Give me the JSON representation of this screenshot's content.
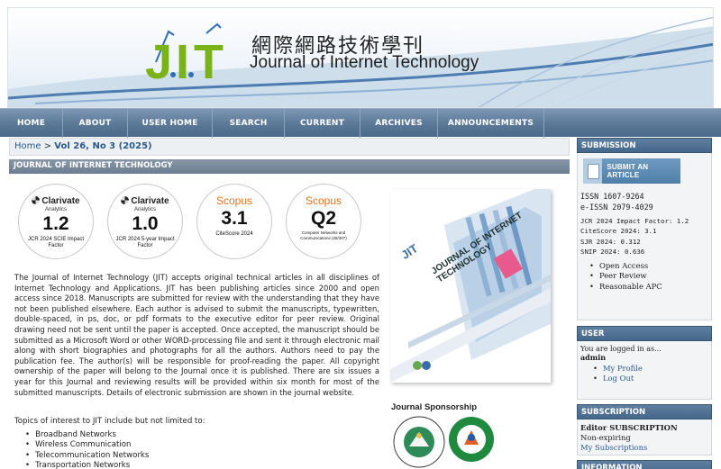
{
  "header": {
    "logo_text": "JIT",
    "title_cn": "網際網路技術學刊",
    "title_en": "Journal of Internet Technology"
  },
  "nav": [
    {
      "label": "HOME"
    },
    {
      "label": "ABOUT"
    },
    {
      "label": "USER HOME"
    },
    {
      "label": "SEARCH"
    },
    {
      "label": "CURRENT"
    },
    {
      "label": "ARCHIVES"
    },
    {
      "label": "ANNOUNCEMENTS"
    }
  ],
  "breadcrumb": {
    "home": "Home",
    "sep": ">",
    "current": "Vol 26, No 3 (2025)"
  },
  "section_title": "JOURNAL OF INTERNET TECHNOLOGY",
  "badges": [
    {
      "brand": "Clarivate",
      "brand_sub": "Analytics",
      "value": "1.2",
      "caption": "JCR 2024 SCIE Impact Factor"
    },
    {
      "brand": "Clarivate",
      "brand_sub": "Analytics",
      "value": "1.0",
      "caption": "JCR 2024 5-year Impact Factor"
    },
    {
      "brand": "Scopus",
      "value": "3.1",
      "caption": "CiteScore 2024"
    },
    {
      "brand": "Scopus",
      "value": "Q2",
      "caption": "Computer Networks and Communications (28/307)"
    }
  ],
  "intro": "The Journal of Internet Technology (JIT) accepts original technical articles in all disciplines of Internet Technology and Applications. JIT has been publishing articles since 2000 and open access since 2018. Manuscripts are submitted for review with the understanding that they have not been published elsewhere. Each author is advised to submit the manuscripts, typewritten, double-spaced, in ps, doc, or pdf formats to the executive editor for peer review. Original drawing need not be sent until the paper is accepted. Once accepted, the manuscript should be submitted as a Microsoft Word or other WORD-processing file and sent it through electronic mail along with short biographies and photographs for all the authors. Authors need to pay the publication fee. The author(s) will be responsible for proof-reading the paper. All copyright ownership of the paper will belong to the Journal once it is published. There are six issues a year for this Journal and reviewing results will be provided within six month for most of the submitted manuscripts. Details of electronic submission are shown in the journal website.",
  "topics_heading": "Topics of interest to JIT include but not limited to:",
  "topics": [
    "Broadband Networks",
    "Wireless Communication",
    "Telecommunication Networks",
    "Transportation Networks"
  ],
  "cover": {
    "title": "JOURNAL OF INTERNET TECHNOLOGY",
    "logo": "JIT"
  },
  "sponsorship": {
    "heading": "Journal Sponsorship"
  },
  "sidebar": {
    "submission": {
      "heading": "SUBMISSION",
      "button_label": "SUBMIT AN ARTICLE",
      "issn": "ISSN 1607-9264",
      "eissn": "e-ISSN 2079-4029",
      "metrics": [
        "JCR 2024 Impact Factor: 1.2",
        "CiteScore 2024: 3.1",
        "SJR 2024: 0.312",
        "SNIP 2024: 0.636"
      ],
      "features": [
        "Open Access",
        "Peer Review",
        "Reasonable APC"
      ]
    },
    "user": {
      "heading": "USER",
      "logged_in_as": "You are logged in as...",
      "username": "admin",
      "links": [
        "My Profile",
        "Log Out"
      ]
    },
    "subscription": {
      "heading": "SUBSCRIPTION",
      "title": "Editor SUBSCRIPTION",
      "status": "Non-expiring",
      "link": "My Subscriptions"
    },
    "information": {
      "heading": "INFORMATION"
    }
  },
  "colors": {
    "nav": "#5d7a99",
    "side_head": "#45678a",
    "link": "#2b5a8a",
    "logo_green": "#7ab317",
    "logo_blue": "#2f6db5",
    "scopus_orange": "#e9711c"
  }
}
